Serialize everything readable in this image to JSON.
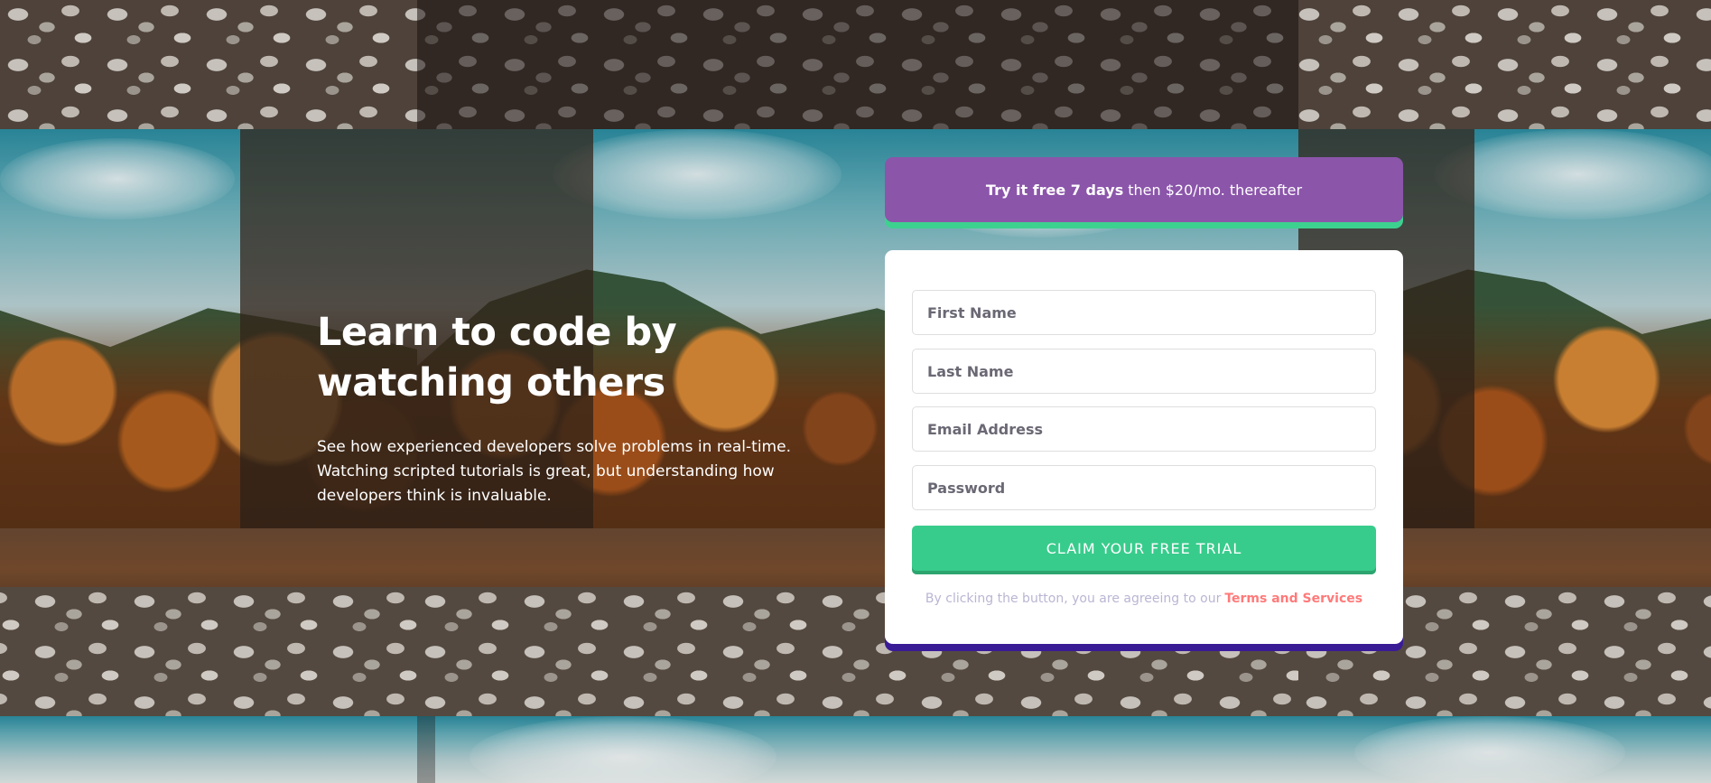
{
  "hero": {
    "title": "Learn to code by watching others",
    "description": "See how experienced developers solve problems in real-time. Watching scripted tutorials is great, but understanding how developers think is invaluable."
  },
  "promo": {
    "bold": "Try it free 7 days",
    "rest": "then $20/mo. thereafter"
  },
  "form": {
    "first_name_placeholder": "First Name",
    "last_name_placeholder": "Last Name",
    "email_placeholder": "Email Address",
    "password_placeholder": "Password",
    "submit_label": "CLAIM YOUR FREE TRIAL",
    "terms_text": "By clicking the button, you are agreeing to our",
    "terms_link": "Terms and Services"
  },
  "colors": {
    "promo_bg": "#8b55aa",
    "promo_shadow": "#3dd18f",
    "cta_bg": "#38cc8c",
    "card_shadow": "#3a1b96",
    "terms_link": "#ff7a7a"
  }
}
